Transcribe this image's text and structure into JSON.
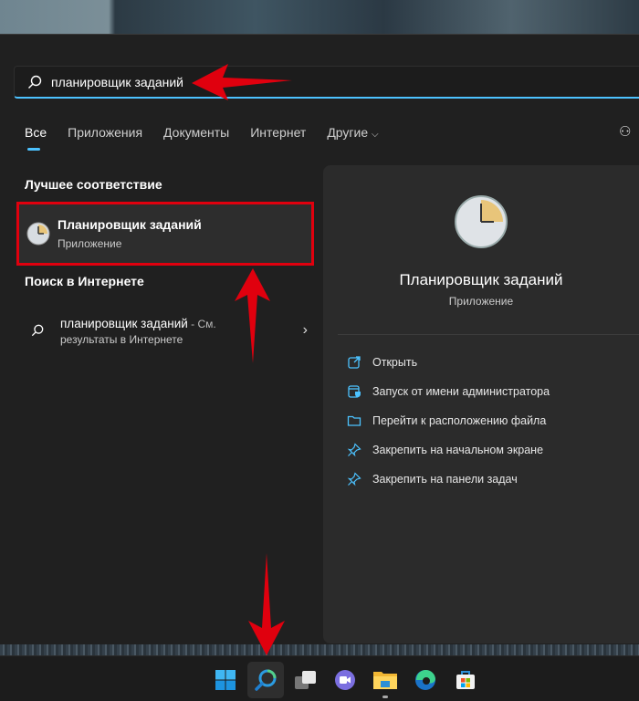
{
  "search": {
    "value": "планировщик заданий",
    "icon": "search-icon"
  },
  "tabs": [
    {
      "label": "Все",
      "active": true
    },
    {
      "label": "Приложения"
    },
    {
      "label": "Документы"
    },
    {
      "label": "Интернет"
    },
    {
      "label": "Другие"
    }
  ],
  "best_match": {
    "heading": "Лучшее соответствие",
    "title": "Планировщик заданий",
    "subtitle": "Приложение",
    "icon": "clock-icon"
  },
  "web": {
    "heading": "Поиск в Интернете",
    "query": "планировщик заданий",
    "suffix": " - См.",
    "line2": "результаты в Интернете"
  },
  "details": {
    "title": "Планировщик заданий",
    "subtitle": "Приложение",
    "actions": [
      {
        "label": "Открыть",
        "icon": "open-external-icon"
      },
      {
        "label": "Запуск от имени администратора",
        "icon": "admin-shield-icon"
      },
      {
        "label": "Перейти к расположению файла",
        "icon": "folder-icon"
      },
      {
        "label": "Закрепить на начальном экране",
        "icon": "pin-icon"
      },
      {
        "label": "Закрепить на панели задач",
        "icon": "pin-icon"
      }
    ]
  },
  "taskbar": [
    "start-icon",
    "search-icon",
    "task-view-icon",
    "chat-icon",
    "file-explorer-icon",
    "edge-icon",
    "store-icon"
  ],
  "colors": {
    "accent": "#4cc2ff",
    "annotation": "#e0000e",
    "panel": "#202020",
    "details_bg": "#2b2b2b"
  }
}
